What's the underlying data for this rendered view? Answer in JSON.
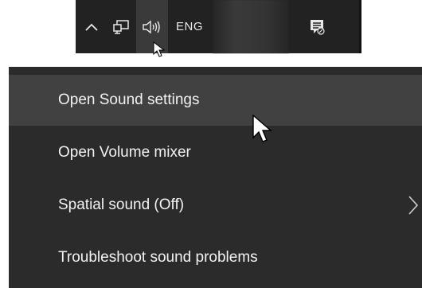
{
  "taskbar": {
    "chevron_icon": "chevron-up-icon",
    "network_icon": "network-icon",
    "volume_icon": "speaker-icon",
    "language": "ENG",
    "action_center_icon": "action-center-icon"
  },
  "context_menu": {
    "items": [
      {
        "label": "Open Sound settings"
      },
      {
        "label": "Open Volume mixer"
      },
      {
        "label": "Spatial sound (Off)",
        "has_submenu": true
      },
      {
        "label": "Troubleshoot sound problems"
      }
    ]
  },
  "colors": {
    "taskbar_bg": "#222222",
    "menu_bg": "#2b2b2b",
    "menu_hover_bg": "#414141",
    "text": "#f2f2f2"
  }
}
